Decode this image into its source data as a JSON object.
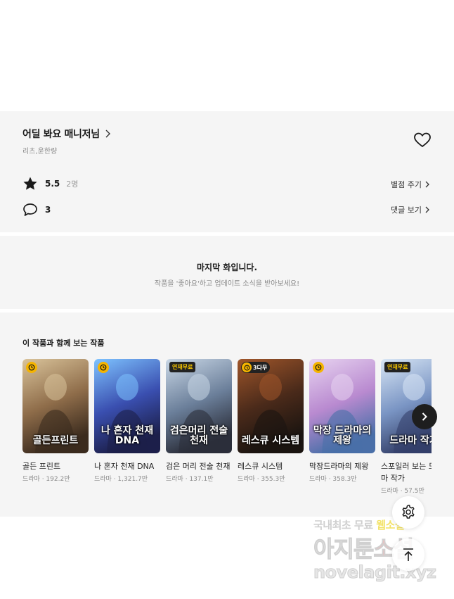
{
  "series": {
    "title": "어딜 봐요 매니저님",
    "authors": "리츠,윤한량",
    "rating": "5.5",
    "rating_count": "2명",
    "rate_link": "별점 주기",
    "comment_count": "3",
    "comment_link": "댓글 보기"
  },
  "last_episode": {
    "title": "마지막 화입니다.",
    "subtitle": "작품을 '좋아요'하고 업데이트 소식을 받아보세요!"
  },
  "recommendations": {
    "heading": "이 작품과 함께 보는 작품",
    "items": [
      {
        "name": "골든 프린트",
        "meta": "드라마 · 192.2만",
        "badge": "clock",
        "cover_text": "골든프린트",
        "colors": [
          "#d9c39a",
          "#8f6d4a",
          "#3b2b1e"
        ]
      },
      {
        "name": "나 혼자 천재 DNA",
        "meta": "드라마 · 1,321.7만",
        "badge": "clock",
        "cover_text": "나 혼자 천재 DNA",
        "colors": [
          "#7ec3ff",
          "#3a4fb0",
          "#1c1f4a"
        ]
      },
      {
        "name": "검은 머리 전술 천재",
        "meta": "드라마 · 137.1만",
        "badge": "free",
        "badge_text": "연재무료",
        "cover_text": "검은머리 전술천재",
        "colors": [
          "#c9d7e6",
          "#6b7f9a",
          "#2b2e3a"
        ]
      },
      {
        "name": "레스큐 시스템",
        "meta": "드라마 · 355.3만",
        "badge": "pill",
        "badge_text": "3다무",
        "cover_text": "레스큐 시스템",
        "colors": [
          "#a0562a",
          "#4a2a1a",
          "#1a1410"
        ]
      },
      {
        "name": "막장드라마의 제왕",
        "meta": "드라마 · 358.3만",
        "badge": "clock",
        "cover_text": "막장 드라마의 제왕",
        "colors": [
          "#e7d3f0",
          "#b98ad0",
          "#4a6fa8"
        ]
      },
      {
        "name": "스포일러 보는 드라마 작가",
        "meta": "드라마 · 57.5만",
        "badge": "free",
        "badge_text": "연재무료",
        "cover_text": "드라마 작가",
        "colors": [
          "#d8e6f5",
          "#7a95c4",
          "#34406a"
        ]
      }
    ]
  },
  "watermark": {
    "line1_a": "국내최초 무료 ",
    "line1_b": "웹소설",
    "line2_a": "아지툰",
    "line2_b": "소설",
    "line3": "novelagit.xyz"
  },
  "icons": {
    "heart": "heart-outline-icon",
    "star": "star-icon",
    "comment": "speech-bubble-icon",
    "settings": "gear-icon",
    "top": "arrow-up-icon",
    "next": "chevron-right-icon"
  }
}
